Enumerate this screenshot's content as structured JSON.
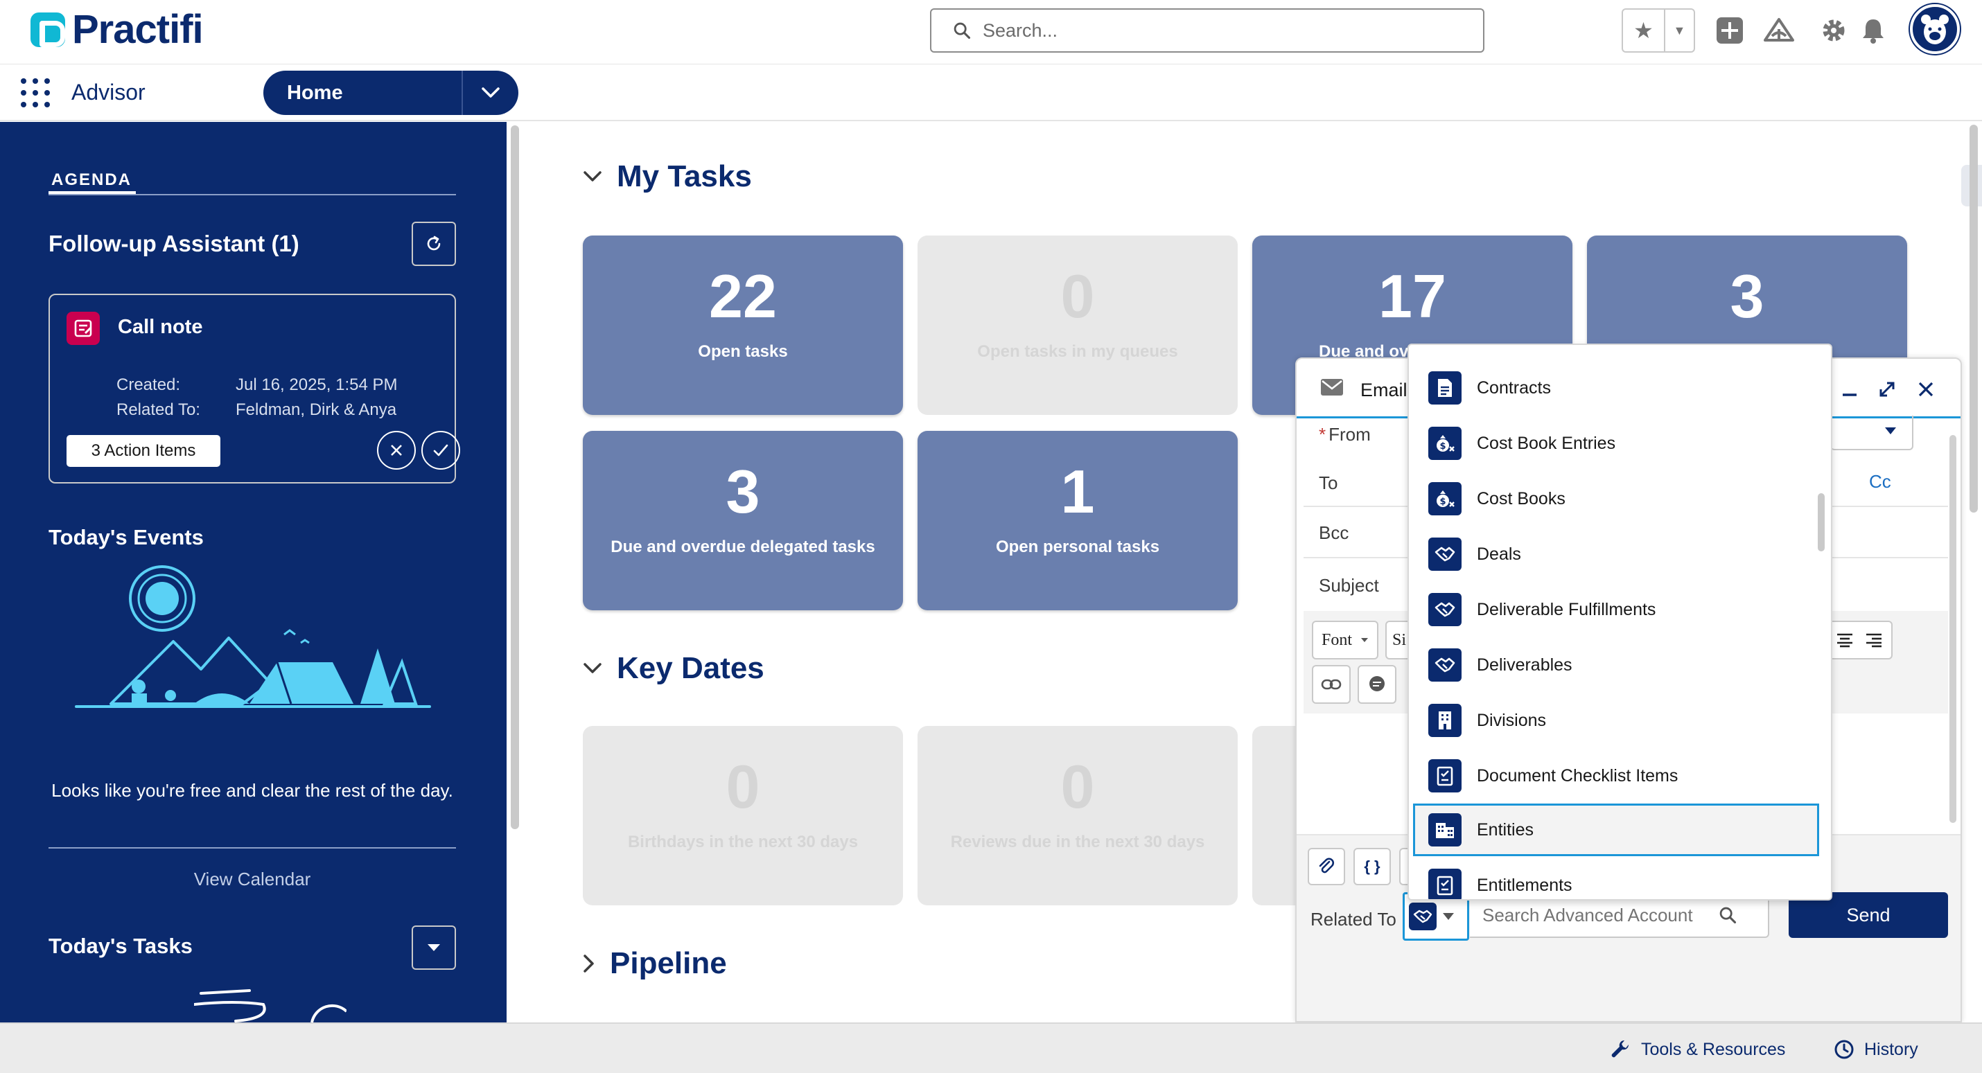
{
  "header": {
    "logo_text": "Practifi",
    "search_placeholder": "Search...",
    "icons": [
      "star-icon",
      "chevron-down-icon",
      "add-icon",
      "trailhead-icon",
      "gear-icon",
      "bell-icon",
      "avatar-icon"
    ]
  },
  "nav": {
    "app_name": "Advisor",
    "tab_label": "Home"
  },
  "sidebar": {
    "agenda_label": "AGENDA",
    "follow_up_title": "Follow-up Assistant (1)",
    "call_note": {
      "title": "Call note",
      "created_label": "Created:",
      "created_value": "Jul 16, 2025, 1:54 PM",
      "related_label": "Related To:",
      "related_value": "Feldman, Dirk & Anya",
      "action_items": "3 Action Items"
    },
    "events_title": "Today's Events",
    "free_text": "Looks like you're free and clear the rest of the day.",
    "view_calendar": "View Calendar",
    "tasks_title": "Today's Tasks"
  },
  "main": {
    "my_tasks": {
      "title": "My Tasks",
      "tiles": [
        {
          "value": "22",
          "label": "Open tasks"
        },
        {
          "value": "0",
          "label": "Open tasks in my queues"
        },
        {
          "value": "17",
          "label": "Due and ov"
        },
        {
          "value": "3",
          "label": ""
        },
        {
          "value": "3",
          "label": "Due and overdue delegated tasks"
        },
        {
          "value": "1",
          "label": "Open personal tasks"
        }
      ]
    },
    "key_dates": {
      "title": "Key Dates",
      "tiles": [
        {
          "value": "0",
          "label": "Birthdays in the next 30 days"
        },
        {
          "value": "0",
          "label": "Reviews due in the next 30 days"
        }
      ]
    },
    "pipeline": {
      "title": "Pipeline"
    }
  },
  "composer": {
    "title": "Email",
    "from_label": "From",
    "to_label": "To",
    "cc_label": "Cc",
    "bcc_label": "Bcc",
    "subject_label": "Subject",
    "font_label": "Font",
    "size_label": "Si",
    "related_label": "Related To",
    "related_placeholder": "Search Advanced Account",
    "send_label": "Send"
  },
  "object_dropdown": {
    "items": [
      {
        "label": "Contracts",
        "icon": "contract-icon"
      },
      {
        "label": "Cost Book Entries",
        "icon": "money-icon"
      },
      {
        "label": "Cost Books",
        "icon": "money-icon"
      },
      {
        "label": "Deals",
        "icon": "handshake-icon"
      },
      {
        "label": "Deliverable Fulfillments",
        "icon": "handshake-icon"
      },
      {
        "label": "Deliverables",
        "icon": "handshake-icon"
      },
      {
        "label": "Divisions",
        "icon": "building-icon"
      },
      {
        "label": "Document Checklist Items",
        "icon": "checklist-icon"
      },
      {
        "label": "Entities",
        "icon": "buildings-icon"
      },
      {
        "label": "Entitlements",
        "icon": "checklist-icon"
      }
    ],
    "selected": "Entities"
  },
  "utility_bar": {
    "tools_label": "Tools & Resources",
    "history_label": "History"
  },
  "colors": {
    "brand_navy": "#0b2a6e",
    "accent_blue": "#1b96d8",
    "tile_blue": "#6a7fae",
    "logo_teal": "#10b8d4",
    "note_pink": "#c9004f"
  }
}
